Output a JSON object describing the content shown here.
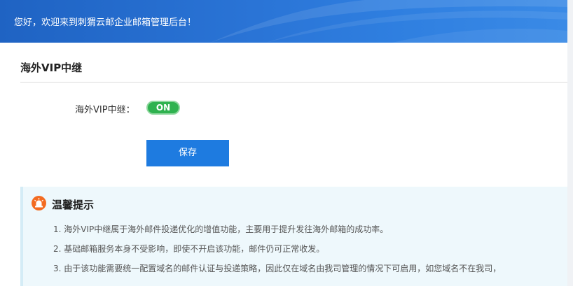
{
  "header": {
    "greeting": "您好，欢迎来到刺猬云邮企业邮箱管理后台！"
  },
  "section": {
    "title": "海外VIP中继"
  },
  "form": {
    "label": "海外VIP中继：",
    "toggle_state": "ON",
    "save_label": "保存"
  },
  "tips": {
    "icon": "alert-siren-icon",
    "title": "温馨提示",
    "items": [
      "1. 海外VIP中继属于海外邮件投递优化的增值功能，主要用于提升发往海外邮箱的成功率。",
      "2. 基础邮箱服务本身不受影响，即使不开启该功能，邮件仍可正常收发。",
      "3. 由于该功能需要统一配置域名的邮件认证与投递策略，因此仅在域名由我司管理的情况下可启用，如您域名不在我司，"
    ]
  },
  "colors": {
    "header_blue": "#2a74d6",
    "toggle_green": "#2fb24f",
    "button_blue": "#1e7be0",
    "tips_bg": "#eef8fc",
    "icon_orange": "#f36b21"
  }
}
